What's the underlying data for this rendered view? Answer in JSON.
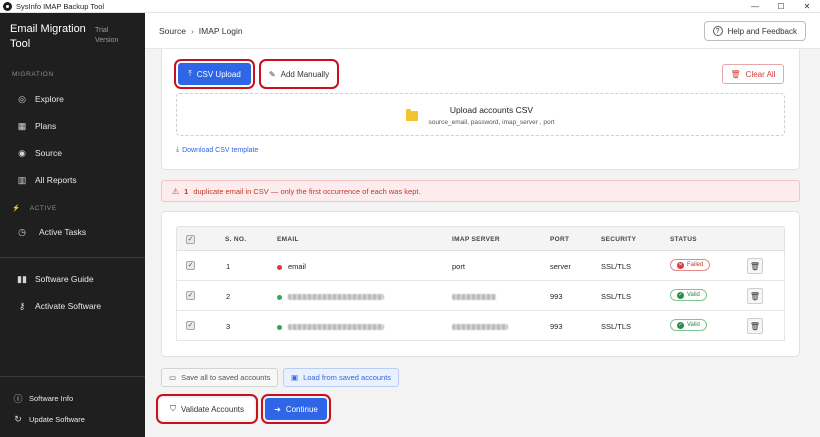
{
  "window": {
    "title": "SysInfo IMAP Backup Tool",
    "controls": [
      "—",
      "☐",
      "✕"
    ]
  },
  "sidebar": {
    "brand": "Email Migration Tool",
    "trial": "Trial Version",
    "section_migration": "MIGRATION",
    "explore": "Explore",
    "plans": "Plans",
    "source": "Source",
    "reports": "All Reports",
    "section_active": "ACTIVE",
    "active_tasks": "Active Tasks",
    "software_guide": "Software Guide",
    "activate_software": "Activate Software",
    "software_info": "Software Info",
    "update_software": "Update Software"
  },
  "header": {
    "breadcrumb": [
      "Source",
      "IMAP Login"
    ],
    "breadcrumb_sep": "›",
    "help_label": "Help and Feedback"
  },
  "upload": {
    "csv_upload": "CSV Upload",
    "add_manually": "Add Manually",
    "clear_all": "Clear All",
    "drop_title": "Upload accounts CSV",
    "drop_sub": "source_email, password, imap_server , port",
    "download_template": "Download CSV template"
  },
  "alert": {
    "count": "1",
    "message": "duplicate email in CSV — only the first occurrence of each was kept."
  },
  "table": {
    "columns": [
      "S. NO.",
      "EMAIL",
      "IMAP SERVER",
      "PORT",
      "SECURITY",
      "STATUS"
    ],
    "rows": [
      {
        "sno": "1",
        "email": "email",
        "email_blurred": false,
        "server": "port",
        "server_blurred": false,
        "port": "server",
        "security": "SSL/TLS",
        "status": "Failed",
        "dot_color": "#d63a3a"
      },
      {
        "sno": "2",
        "email": "",
        "email_blurred": true,
        "server": "",
        "server_blurred": true,
        "port": "993",
        "security": "SSL/TLS",
        "status": "Valid",
        "dot_color": "#2eaa55"
      },
      {
        "sno": "3",
        "email": "",
        "email_blurred": true,
        "server": "",
        "server_blurred": true,
        "port": "993",
        "security": "SSL/TLS",
        "status": "Valid",
        "dot_color": "#2eaa55"
      }
    ]
  },
  "footer": {
    "save_all": "Save all to saved accounts",
    "load_saved": "Load from saved accounts",
    "validate": "Validate Accounts",
    "continue": "Continue"
  },
  "colors": {
    "primary": "#2f66e8",
    "danger": "#d93a3a",
    "success": "#2e8b46",
    "highlight": "#c8101e"
  }
}
